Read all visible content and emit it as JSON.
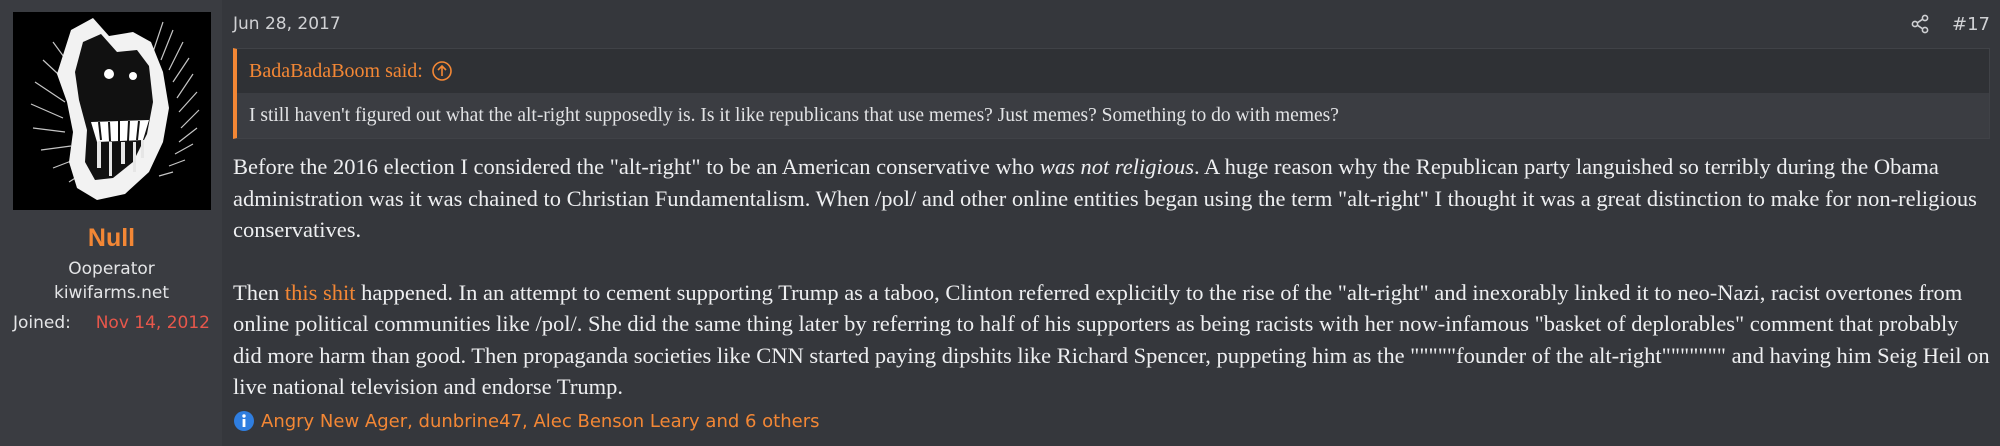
{
  "user": {
    "name": "Null",
    "title": "Ooperator",
    "site": "kiwifarms.net",
    "joined_label": "Joined:",
    "joined_date": "Nov 14, 2012"
  },
  "post": {
    "date": "Jun 28, 2017",
    "number": "#17"
  },
  "quote": {
    "attribution": "BadaBadaBoom said:",
    "text": "I still haven't figured out what the alt-right supposedly is. Is it like republicans that use memes? Just memes? Something to do with memes?"
  },
  "message": {
    "p1_a": "Before the 2016 election I considered the \"alt-right\" to be an American conservative who ",
    "p1_em": "was not religious",
    "p1_b": ". A huge reason why the Republican party languished so terribly during the Obama administration was it was chained to Christian Fundamentalism. When /pol/ and other online entities began using the term \"alt-right\" I thought it was a great distinction to make for non-religious conservatives.",
    "p2_a": "Then ",
    "p2_link": "this shit",
    "p2_b": " happened. In an attempt to cement supporting Trump as a taboo, Clinton referred explicitly to the rise of the \"alt-right\" and inexorably linked it to neo-Nazi, racist overtones from online political communities like /pol/. She did the same thing later by referring to half of his supporters as being racists with her now-infamous \"basket of deplorables\" comment that probably did more harm than good. Then propaganda societies like CNN started paying dipshits like Richard Spencer, puppeting him as the \"\"\"\"\"founder of the alt-right\"\"\"\"\"\"\" and having him Seig Heil on live national television and endorse Trump."
  },
  "reactions": {
    "text": "Angry New Ager, dunbrine47, Alec Benson Leary and 6 others"
  },
  "colors": {
    "accent": "#f38735",
    "joined_date": "#e8574b",
    "info_icon": "#2f7ee0"
  },
  "icons": [
    "share-icon",
    "quote-arrow-icon",
    "info-icon"
  ]
}
